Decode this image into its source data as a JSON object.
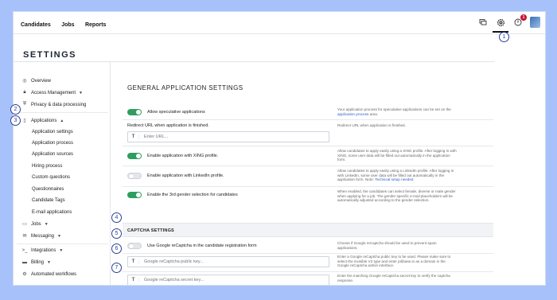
{
  "topnav": {
    "candidates": "Candidates",
    "jobs": "Jobs",
    "reports": "Reports"
  },
  "notifications": {
    "count": "1"
  },
  "page": {
    "title": "SETTINGS"
  },
  "sidebar": {
    "overview": "Overview",
    "access_management": "Access Management",
    "privacy": "Privacy & data processing",
    "applications": "Applications",
    "sub": [
      "Application settings",
      "Application process",
      "Application sources",
      "Hiring process",
      "Custom questions",
      "Questionnaires",
      "Candidate Tags",
      "E-mail applications"
    ],
    "jobs": "Jobs",
    "messaging": "Messaging",
    "integrations": "Integrations",
    "billing": "Billing",
    "workflows": "Automated workflows"
  },
  "main": {
    "section_title": "GENERAL APPLICATION SETTINGS",
    "speculative": {
      "label": "Allow speculative applications",
      "help": "Your application process for speculative applications can be set on the",
      "help_link": "application process",
      "help_end": "area."
    },
    "redirect": {
      "label": "Redirect URL when application is finished.",
      "placeholder": "Enter URL...",
      "help": "Redirect URL when application is finished."
    },
    "xing": {
      "label": "Enable application with XING profile.",
      "help": "Allow candidates to apply easily using a XING profile. After logging in with XING, some user data will be filled out automatically in the application form."
    },
    "linkedin": {
      "label": "Enable application with LinkedIn profile.",
      "help": "Allow candidates to apply easily using a LinkedIn profile. After logging in with LinkedIn, some user data will be filled out automatically in the application form. Note:",
      "help_link": "Technical setup needed"
    },
    "gender": {
      "label": "Enable the 3rd gender selection for candidates",
      "help": "When enabled, the candidates can select female, diverse or male gender when applying for a job. The gender specific e-mail placeholders will be automatically adjusted according to the gender selection."
    },
    "captcha_title": "CAPTCHA SETTINGS",
    "recaptcha": {
      "label": "Use Google reCaptcha in the candidate registration form",
      "help": "Choose if Google reCaptcha should be used to prevent spam applications."
    },
    "public_key": {
      "placeholder": "Google reCaptcha public key...",
      "help": "Enter a Google reCaptcha public key to be used. Please make sure to select the invisible V2 type and enter jobbase.io as a domain in the Google reCaptcha admin interface."
    },
    "secret_key": {
      "placeholder": "Google reCaptcha secret key...",
      "help": "Enter the matching Google reCaptcha secret key to verify the captcha response."
    }
  },
  "callouts": [
    "1",
    "2",
    "3",
    "4",
    "5",
    "6",
    "7"
  ],
  "colors": {
    "toggle_on": "#2e9e5f",
    "link": "#2a5fc9",
    "callout": "#2b3f99",
    "badge": "#c8102e",
    "background": "#a7c2fb"
  }
}
